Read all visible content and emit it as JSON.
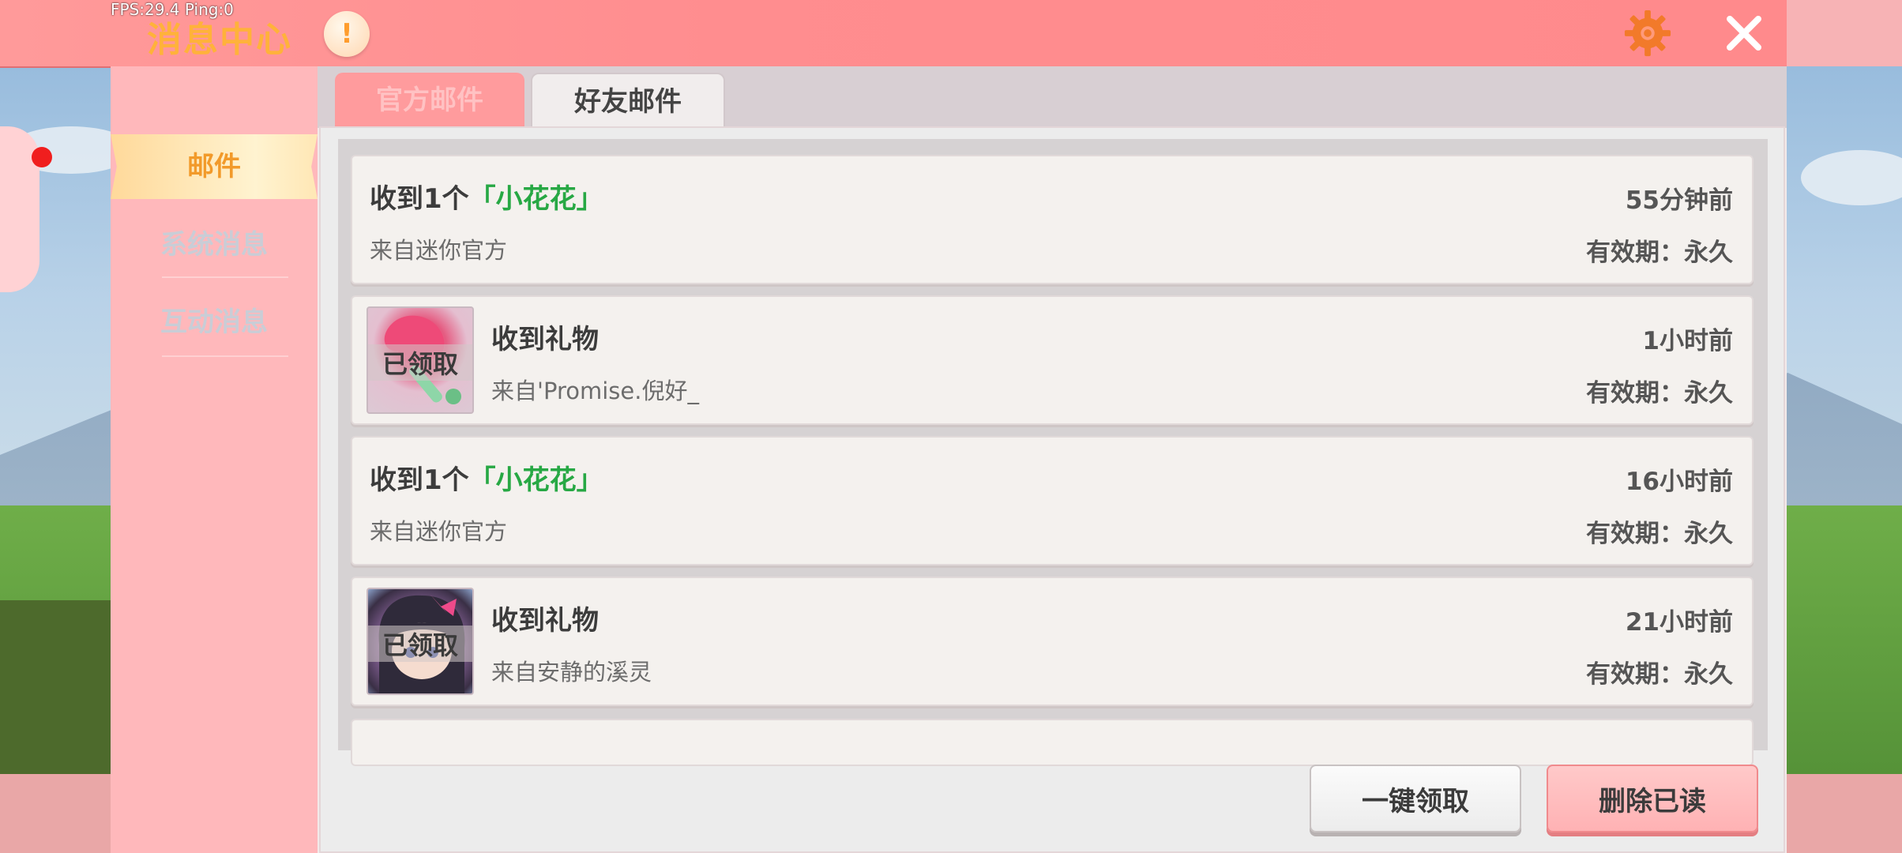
{
  "header": {
    "fps_text": "FPS:29.4  Ping:0",
    "title": "消息中心",
    "alert_symbol": "!"
  },
  "sidebar": {
    "items": [
      {
        "label": "邮件",
        "active": true
      },
      {
        "label": "系统消息",
        "active": false
      },
      {
        "label": "互动消息",
        "active": false
      }
    ]
  },
  "tabs": [
    {
      "label": "官方邮件",
      "active": false
    },
    {
      "label": "好友邮件",
      "active": true
    }
  ],
  "mails": [
    {
      "title_prefix": "收到1个",
      "title_highlight": "「小花花」",
      "from": "来自迷你官方",
      "time": "55分钟前",
      "expiry": "有效期：永久",
      "has_thumb": false
    },
    {
      "title_prefix": "收到礼物",
      "title_highlight": "",
      "from": "来自'Promise.倪好_",
      "time": "1小时前",
      "expiry": "有效期：永久",
      "has_thumb": true,
      "thumb_label": "已领取",
      "thumb_icon": "lollipop-gift-icon"
    },
    {
      "title_prefix": "收到1个",
      "title_highlight": "「小花花」",
      "from": "来自迷你官方",
      "time": "16小时前",
      "expiry": "有效期：永久",
      "has_thumb": false
    },
    {
      "title_prefix": "收到礼物",
      "title_highlight": "",
      "from": "来自安静的溪灵",
      "time": "21小时前",
      "expiry": "有效期：永久",
      "has_thumb": true,
      "thumb_label": "已领取",
      "thumb_icon": "avatar-gift-icon"
    }
  ],
  "footer": {
    "claim_all_label": "一键领取",
    "delete_read_label": "删除已读"
  },
  "colors": {
    "header_bg": "#ff8d8f",
    "accent_orange": "#f29a2a",
    "highlight_green": "#27a844"
  }
}
